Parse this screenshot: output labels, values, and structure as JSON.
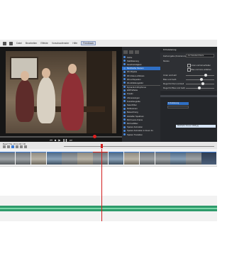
{
  "menu": {
    "items": [
      "Datei",
      "Bearbeiten",
      "Effekte",
      "Vorschaufenster",
      "Hilfe",
      "Feedback"
    ]
  },
  "effects_panel": {
    "items": [
      {
        "label": "Farbe"
      },
      {
        "label": "Stabilisierung"
      },
      {
        "label": "Geschwindigkeit"
      },
      {
        "label": "Mehrfache Szenen",
        "selected": true
      },
      {
        "label": "3D-Objekte"
      },
      {
        "label": "3D-Video-Lichtkreis"
      },
      {
        "label": "3D-Lichtquellen"
      },
      {
        "label": "3D-Abbildungsbild"
      },
      {
        "label": "Dynamik & Rhythmus",
        "separator": true
      },
      {
        "label": "ERP Effekte"
      },
      {
        "label": "Kreativ"
      },
      {
        "label": "Abmessungen"
      },
      {
        "label": "Kunstfotografie"
      },
      {
        "label": "Natur/Filter"
      },
      {
        "label": "Reflexionen"
      },
      {
        "label": "Beleuchtung"
      },
      {
        "label": "Zeitraffer Spektrum"
      },
      {
        "label": "Mit Freeze-Frame"
      },
      {
        "label": "Mit Farbfilter"
      },
      {
        "label": "Sparen Animation"
      },
      {
        "label": "Sparen Animation in Zoom Fx"
      },
      {
        "label": "Sparen Transition"
      }
    ]
  },
  "settings_panel": {
    "title": "KI Kolorierung",
    "model_label": "Farbvorgabe (Kolorierung)",
    "model_value": "Auf Standard-Werte",
    "mode_label": "Modus",
    "check_1": "Unter und hell aufhellen",
    "check_2": "Blau und Grün einfärben",
    "slider_1_label": "Unter und Hell",
    "slider_2_label": "Blau und Gelb",
    "slider_3_label": "Regel für Klar und Hell",
    "slider_4_label": "Regel für Blau und Gelb"
  },
  "sliders": {
    "s1": 0.72,
    "s2": 0.55,
    "s3": 0.62,
    "s4": 0.48
  },
  "right_panel": {
    "track_label": "KI Kolorierung",
    "file_name": "Mehrfache Szenen 1998.jpg"
  },
  "timeline": {
    "date": "Bearf Tha, 20.11.00 / 00",
    "clip_count": 14
  },
  "colors": {
    "accent": "#3a7bd5",
    "selected_effect": "#2f6fc4",
    "playhead": "#d21f1f",
    "audio_track": "#2e9b6b"
  },
  "icons": [
    "file-icon",
    "folder-icon",
    "play-icon",
    "pause-icon",
    "stop-icon",
    "skip-back-icon",
    "skip-forward-icon"
  ]
}
